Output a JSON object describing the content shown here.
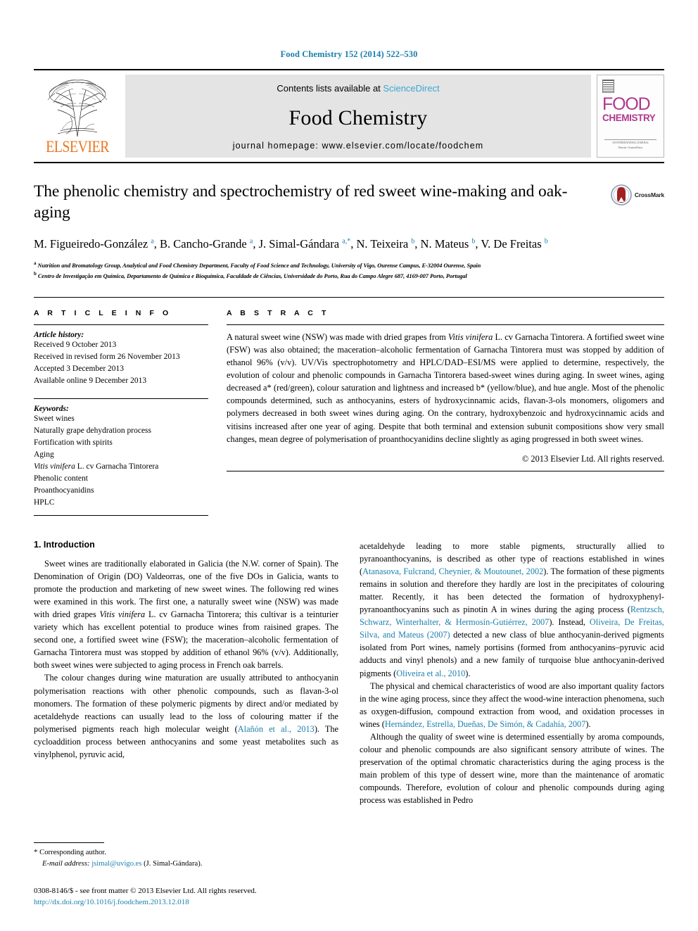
{
  "running_head": "Food Chemistry 152 (2014) 522–530",
  "masthead": {
    "publisher": "ELSEVIER",
    "contents_prefix": "Contents lists available at ",
    "sciencedirect": "ScienceDirect",
    "journal_title": "Food Chemistry",
    "homepage": "journal homepage: www.elsevier.com/locate/foodchem",
    "cover": {
      "line1": "FOOD",
      "line2": "CHEMISTRY",
      "footer1": "AN INTERNATIONAL JOURNAL",
      "footer2": "Elsevier | ScienceDirect"
    }
  },
  "article": {
    "title": "The phenolic chemistry and spectrochemistry of red sweet wine-making and oak-aging",
    "crossmark_label": "CrossMark",
    "authors_html": "M. Figueiredo-González <sup>a</sup>, B. Cancho-Grande <sup>a</sup>, J. Simal-Gándara <sup>a,*</sup>, N. Teixeira <sup>b</sup>, N. Mateus <sup>b</sup>, V. De Freitas <sup>b</sup>",
    "affiliation_a": "Nutrition and Bromatology Group, Analytical and Food Chemistry Department, Faculty of Food Science and Technology, University of Vigo, Ourense Campus, E-32004 Ourense, Spain",
    "affiliation_b": "Centro de Investigação em Química, Departamento de Química e Bioquímica, Faculdade de Ciências, Universidade do Porto, Rua do Campo Alegre 687, 4169-007 Porto, Portugal"
  },
  "article_info": {
    "heading": "A R T I C L E   I N F O",
    "history_label": "Article history:",
    "history": [
      "Received 9 October 2013",
      "Received in revised form 26 November 2013",
      "Accepted 3 December 2013",
      "Available online 9 December 2013"
    ],
    "keywords_label": "Keywords:",
    "keywords": [
      "Sweet wines",
      "Naturally grape dehydration process",
      "Fortification with spirits",
      "Aging",
      "Vitis vinifera L. cv Garnacha Tintorera",
      "Phenolic content",
      "Proanthocyanidins",
      "HPLC"
    ]
  },
  "abstract": {
    "heading": "A B S T R A C T",
    "text_html": "A natural sweet wine (NSW) was made with dried grapes from <i>Vitis vinifera</i> L. cv Garnacha Tintorera. A fortified sweet wine (FSW) was also obtained; the maceration–alcoholic fermentation of Garnacha Tintorera must was stopped by addition of ethanol 96% (v/v). UV/Vis spectrophotometry and HPLC/DAD–ESI/MS were applied to determine, respectively, the evolution of colour and phenolic compounds in Garnacha Tintorera based-sweet wines during aging. In sweet wines, aging decreased a* (red/green), colour saturation and lightness and increased b* (yellow/blue), and hue angle. Most of the phenolic compounds determined, such as anthocyanins, esters of hydroxycinnamic acids, flavan-3-ols monomers, oligomers and polymers decreased in both sweet wines during aging. On the contrary, hydroxybenzoic and hydroxycinnamic acids and vitisins increased after one year of aging. Despite that both terminal and extension subunit compositions show very small changes, mean degree of polymerisation of proanthocyanidins decline slightly as aging progressed in both sweet wines.",
    "copyright": "© 2013 Elsevier Ltd. All rights reserved."
  },
  "introduction": {
    "section_title": "1. Introduction",
    "left_paragraphs_html": [
      "Sweet wines are traditionally elaborated in Galicia (the N.W. corner of Spain). The Denomination of Origin (DO) Valdeorras, one of the five DOs in Galicia, wants to promote the production and marketing of new sweet wines. The following red wines were examined in this work. The first one, a naturally sweet wine (NSW) was made with dried grapes <i>Vitis vinifera</i> L. cv Garnacha Tintorera; this cultivar is a teinturier variety which has excellent potential to produce wines from raisined grapes. The second one, a fortified sweet wine (FSW); the maceration–alcoholic fermentation of Garnacha Tintorera must was stopped by addition of ethanol 96% (v/v). Additionally, both sweet wines were subjected to aging process in French oak barrels.",
      "The colour changes during wine maturation are usually attributed to anthocyanin polymerisation reactions with other phenolic compounds, such as flavan-3-ol monomers. The formation of these polymeric pigments by direct and/or mediated by acetaldehyde reactions can usually lead to the loss of colouring matter if the polymerised pigments reach high molecular weight (<span class=\"ref\">Alañón et al., 2013</span>). The cycloaddition process between anthocyanins and some yeast metabolites such as vinylphenol, pyruvic acid,"
    ],
    "right_paragraphs_html": [
      "acetaldehyde leading to more stable pigments, structurally allied to pyranoanthocyanins, is described as other type of reactions established in wines (<span class=\"ref\">Atanasova, Fulcrand, Cheynier, &amp; Moutounet, 2002</span>). The formation of these pigments remains in solution and therefore they hardly are lost in the precipitates of colouring matter. Recently, it has been detected the formation of hydroxyphenyl-pyranoanthocyanins such as pinotin A in wines during the aging process (<span class=\"ref\">Rentzsch, Schwarz, Winterhalter, &amp; Hermosín-Gutiérrez, 2007</span>). Instead, <span class=\"ref\">Oliveira, De Freitas, Silva, and Mateus (2007)</span> detected a new class of blue anthocyanin-derived pigments isolated from Port wines, namely portisins (formed from anthocyanins–pyruvic acid adducts and vinyl phenols) and a new family of turquoise blue anthocyanin-derived pigments (<span class=\"ref\">Oliveira et al., 2010</span>).",
      "The physical and chemical characteristics of wood are also important quality factors in the wine aging process, since they affect the wood-wine interaction phenomena, such as oxygen-diffusion, compound extraction from wood, and oxidation processes in wines (<span class=\"ref\">Hernández, Estrella, Dueñas, De Simón, &amp; Cadahía, 2007</span>).",
      "Although the quality of sweet wine is determined essentially by aroma compounds, colour and phenolic compounds are also significant sensory attribute of wines. The preservation of the optimal chromatic characteristics during the aging process is the main problem of this type of dessert wine, more than the maintenance of aromatic compounds. Therefore, evolution of colour and phenolic compounds during aging process was established in Pedro"
    ]
  },
  "footnote": {
    "star": "*",
    "corresponding": "Corresponding author.",
    "email_label": "E-mail address:",
    "email": "jsimal@uvigo.es",
    "email_owner": "(J. Simal-Gándara)."
  },
  "footer": {
    "issn_line": "0308-8146/$ - see front matter © 2013 Elsevier Ltd. All rights reserved.",
    "doi": "http://dx.doi.org/10.1016/j.foodchem.2013.12.018"
  },
  "colors": {
    "link_blue": "#1a7fad",
    "elsevier_orange": "#e87722",
    "banner_gray": "#e4e4e4",
    "cover_magenta": "#b0388f"
  }
}
